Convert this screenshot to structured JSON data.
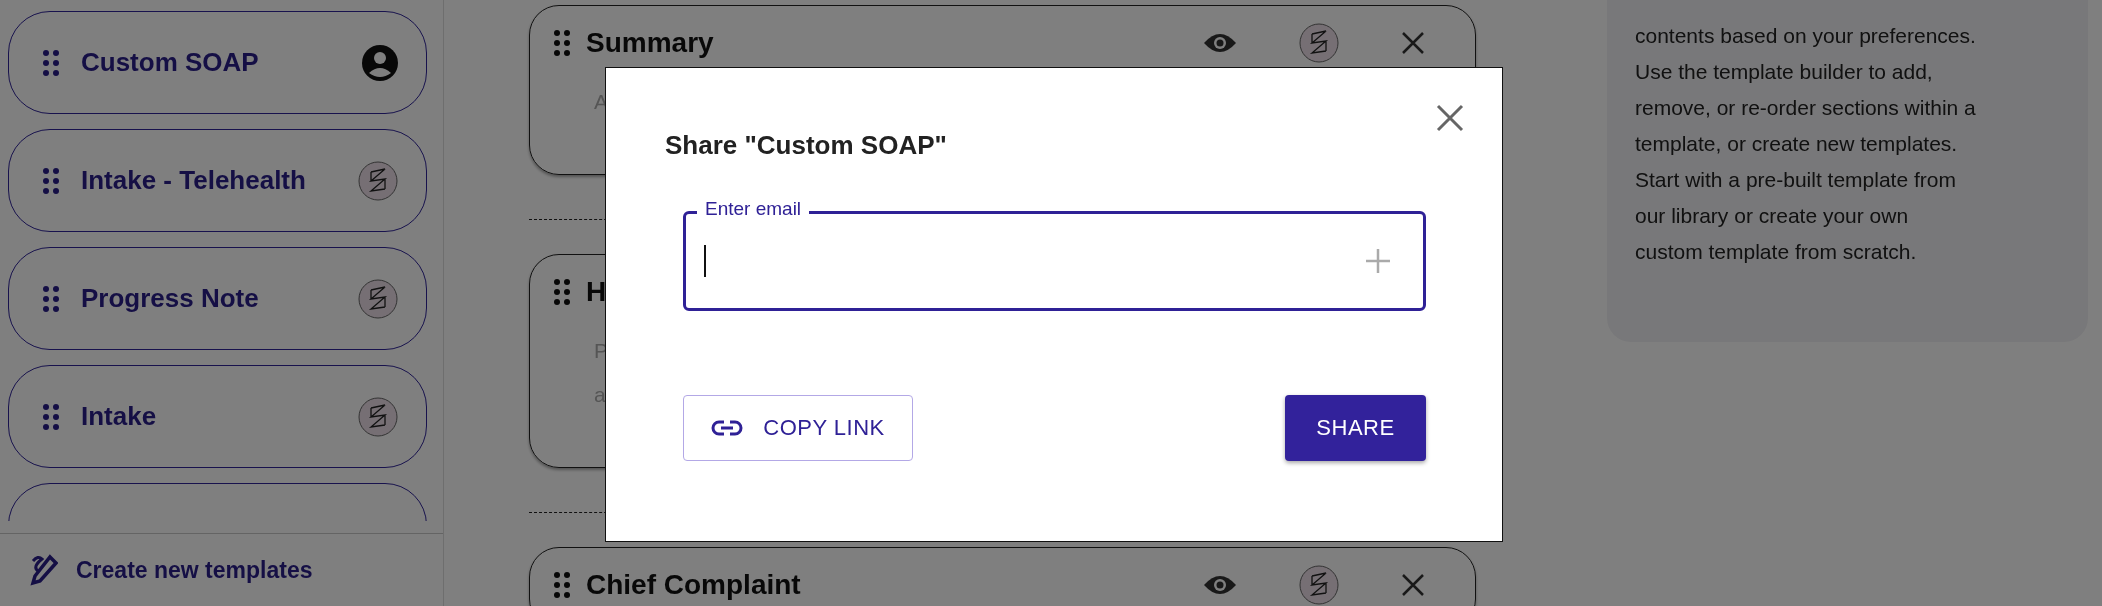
{
  "sidebar": {
    "templates": [
      {
        "name": "Custom SOAP",
        "kind": "custom"
      },
      {
        "name": "Intake - Telehealth",
        "kind": "library"
      },
      {
        "name": "Progress Note",
        "kind": "library"
      },
      {
        "name": "Intake",
        "kind": "library"
      }
    ],
    "create_button": "Create new templates"
  },
  "sections": [
    {
      "title": "Summary",
      "description": [
        "A"
      ],
      "actions": [
        {
          "kind": "eye"
        },
        {
          "kind": "logo"
        },
        {
          "kind": "close"
        }
      ]
    },
    {
      "title": "H",
      "description": [
        "P",
        "a"
      ]
    },
    {
      "title": "Chief Complaint",
      "actions": [
        {
          "kind": "eye"
        },
        {
          "kind": "logo"
        },
        {
          "kind": "close"
        }
      ]
    }
  ],
  "info_panel": {
    "text": "contents based on your preferences.\nUse the template builder to add,\nremove, or re-order sections within a\ntemplate, or create new templates.\nStart with a pre-built template from\nour library or create your own\ncustom template from scratch."
  },
  "dialog": {
    "title": "Share \"Custom SOAP\"",
    "email_field": {
      "label": "Enter email"
    },
    "copy_link": "COPY LINK",
    "share": "SHARE"
  }
}
